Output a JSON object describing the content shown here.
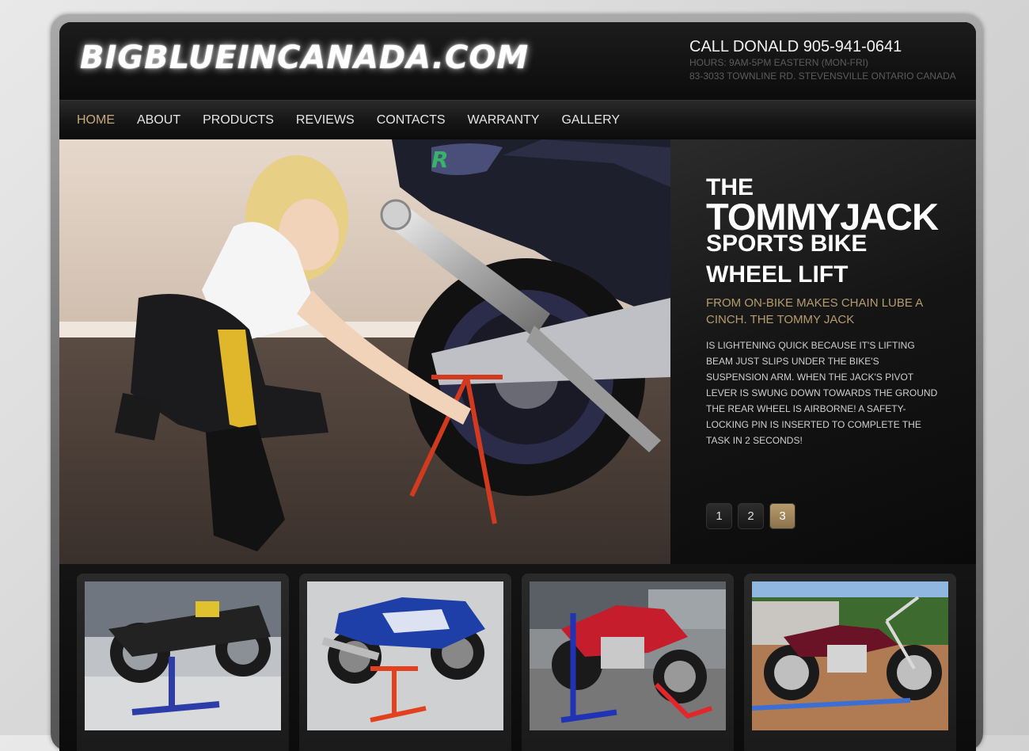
{
  "site": {
    "logo": "BIGBLUEINCANADA.COM"
  },
  "contact": {
    "call": "CALL DONALD 905-941-0641",
    "hours": "HOURS: 9AM-5PM EASTERN (MON-FRI)",
    "address": "83-3033 TOWNLINE RD. STEVENSVILLE ONTARIO CANADA"
  },
  "nav": {
    "items": [
      {
        "label": "HOME"
      },
      {
        "label": "ABOUT"
      },
      {
        "label": "PRODUCTS"
      },
      {
        "label": "REVIEWS"
      },
      {
        "label": "CONTACTS"
      },
      {
        "label": "WARRANTY"
      },
      {
        "label": "GALLERY"
      }
    ],
    "active": "HOME"
  },
  "hero": {
    "line1": "THE",
    "line2": "TOMMYJACK",
    "line3": "SPORTS BIKE",
    "line4": "WHEEL LIFT",
    "subtitle": "FROM ON-BIKE MAKES CHAIN LUBE A CINCH. THE TOMMY JACK",
    "description": "IS LIGHTENING QUICK BECAUSE IT'S LIFTING BEAM JUST SLIPS UNDER THE BIKE'S SUSPENSION ARM. WHEN THE JACK'S PIVOT LEVER IS SWUNG DOWN TOWARDS THE GROUND THE REAR WHEEL IS AIRBORNE! A SAFETY-LOCKING PIN IS INSERTED TO COMPLETE THE TASK IN 2 SECONDS!",
    "pages": [
      "1",
      "2",
      "3"
    ],
    "active_page": "3"
  },
  "colors": {
    "accent": "#c8a97a",
    "active_page": "#a68a5c",
    "background": "#111111"
  }
}
